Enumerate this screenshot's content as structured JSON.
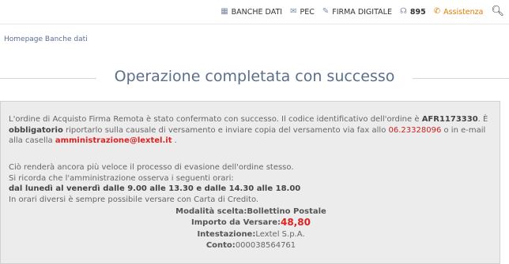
{
  "nav": {
    "banche_dati": "BANCHE DATI",
    "pec": "PEC",
    "firma_digitale": "FIRMA DIGITALE",
    "phone": "895",
    "assistenza": "Assistenza"
  },
  "breadcrumb": "Homepage Banche dati",
  "page_title": "Operazione completata con successo",
  "message": {
    "p1_a": "L'ordine di Acquisto Firma Remota è stato confermato con successo. Il codice identificativo dell'ordine è ",
    "order_code": "AFR1173330",
    "p1_b": ". È ",
    "obbligatorio": "obbligatorio",
    "p1_c": " riportarlo sulla causale di versamento e inviare copia del versamento via fax allo ",
    "fax": "06.23328096",
    "p1_d": " o in e-mail alla casella ",
    "email": "amministrazione@lextel.it",
    "p1_e": " .",
    "p2_line1": "Ciò renderà ancora più veloce il processo di evasione dell'ordine stesso.",
    "p2_line2": "Si ricorda che l'amministrazione osserva i seguenti orari:",
    "p2_hours": "dal lunedì al venerdì dalle 9.00 alle 13.30 e dalle 14.30 alle 18.00",
    "p2_line4": "In orari diversi è sempre possibile versare con Carta di Credito."
  },
  "details": {
    "modalita_label": "Modalità scelta: ",
    "modalita_value": "Bollettino Postale",
    "importo_label": "Importo da Versare:",
    "importo_value": "48,80",
    "intestazione_label": "Intestazione:",
    "intestazione_value": "Lextel S.p.A.",
    "conto_label": "Conto:",
    "conto_value": "000038564761"
  },
  "icons": {
    "banche_dati": "grid-icon",
    "pec": "envelope-icon",
    "firma": "pen-icon",
    "phone": "headset-icon",
    "assistenza": "phone-icon",
    "search": "search-icon"
  },
  "colors": {
    "accent_orange": "#e07b00",
    "title_blue": "#5b6e8a",
    "alert_red": "#dd2222",
    "panel_bg": "#ececec"
  }
}
